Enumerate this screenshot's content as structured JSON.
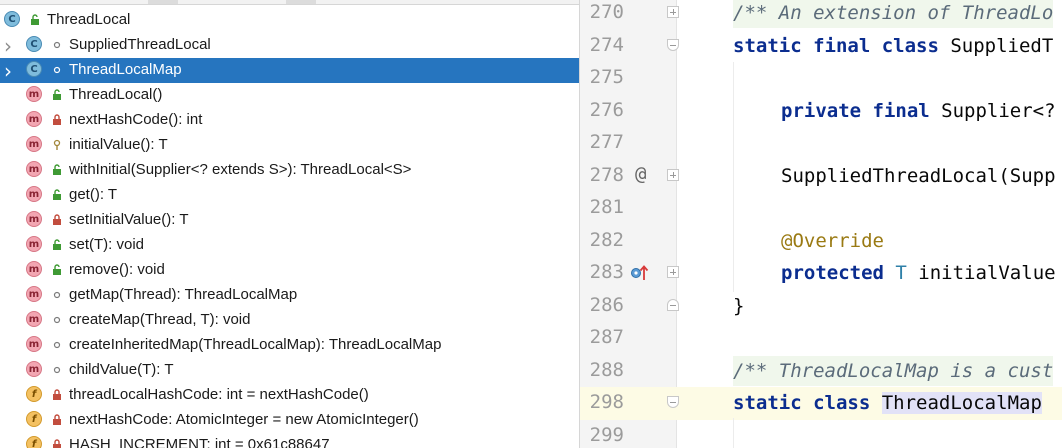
{
  "structure": {
    "root": {
      "label": "ThreadLocal",
      "icon": "class-icon",
      "visibility": "public"
    },
    "items": [
      {
        "label": "SuppliedThreadLocal",
        "icon": "class-icon",
        "visibility": "package",
        "expandable": true
      },
      {
        "label": "ThreadLocalMap",
        "icon": "class-icon",
        "visibility": "package",
        "expandable": true,
        "selected": true
      },
      {
        "label": "ThreadLocal()",
        "icon": "method-icon",
        "visibility": "public"
      },
      {
        "label": "nextHashCode(): int",
        "icon": "method-icon",
        "visibility": "private"
      },
      {
        "label": "initialValue(): T",
        "icon": "method-icon",
        "visibility": "protected"
      },
      {
        "label": "withInitial(Supplier<? extends S>): ThreadLocal<S>",
        "icon": "method-icon",
        "visibility": "public"
      },
      {
        "label": "get(): T",
        "icon": "method-icon",
        "visibility": "public"
      },
      {
        "label": "setInitialValue(): T",
        "icon": "method-icon",
        "visibility": "private"
      },
      {
        "label": "set(T): void",
        "icon": "method-icon",
        "visibility": "public"
      },
      {
        "label": "remove(): void",
        "icon": "method-icon",
        "visibility": "public"
      },
      {
        "label": "getMap(Thread): ThreadLocalMap",
        "icon": "method-icon",
        "visibility": "package"
      },
      {
        "label": "createMap(Thread, T): void",
        "icon": "method-icon",
        "visibility": "package"
      },
      {
        "label": "createInheritedMap(ThreadLocalMap): ThreadLocalMap",
        "icon": "method-icon",
        "visibility": "package"
      },
      {
        "label": "childValue(T): T",
        "icon": "method-icon",
        "visibility": "package"
      },
      {
        "label": "threadLocalHashCode: int = nextHashCode()",
        "icon": "field-icon",
        "visibility": "private"
      },
      {
        "label": "nextHashCode: AtomicInteger = new AtomicInteger()",
        "icon": "field-icon",
        "visibility": "private"
      },
      {
        "label": "HASH_INCREMENT: int = 0x61c88647",
        "icon": "field-icon",
        "visibility": "private"
      }
    ],
    "icon_letters": {
      "class-icon": "C",
      "method-icon": "m",
      "field-icon": "f"
    }
  },
  "editor": {
    "lines": [
      {
        "num": "270",
        "fold": "plus",
        "tokens": [
          [
            "cm",
            "/** An extension of ThreadLo"
          ]
        ],
        "indent": 1,
        "comment_bg": true
      },
      {
        "num": "274",
        "fold": "open",
        "tokens": [
          [
            "kw",
            "static final class"
          ],
          [
            "pl",
            " SuppliedT"
          ]
        ],
        "indent": 1
      },
      {
        "num": "275",
        "tokens": [],
        "indent": 1
      },
      {
        "num": "276",
        "tokens": [
          [
            "kw",
            "private final"
          ],
          [
            "pl",
            " Supplier<?"
          ]
        ],
        "indent": 2
      },
      {
        "num": "277",
        "tokens": [],
        "indent": 2
      },
      {
        "num": "278",
        "mark": "@",
        "fold": "plus",
        "tokens": [
          [
            "pl",
            "SuppliedThreadLocal(Supp"
          ]
        ],
        "indent": 2
      },
      {
        "num": "281",
        "tokens": [],
        "indent": 2
      },
      {
        "num": "282",
        "tokens": [
          [
            "ann",
            "@Override"
          ]
        ],
        "indent": 2
      },
      {
        "num": "283",
        "mark": "override",
        "fold": "plus",
        "tokens": [
          [
            "kw",
            "protected"
          ],
          [
            "pl",
            " "
          ],
          [
            "ty",
            "T"
          ],
          [
            "pl",
            " initialValue"
          ]
        ],
        "indent": 2
      },
      {
        "num": "286",
        "fold": "close",
        "tokens": [
          [
            "pl",
            "}"
          ]
        ],
        "indent": 1
      },
      {
        "num": "287",
        "tokens": [],
        "indent": 1
      },
      {
        "num": "288",
        "tokens": [
          [
            "cm",
            "/** ThreadLocalMap is a cust"
          ]
        ],
        "indent": 1,
        "comment_bg": true
      },
      {
        "num": "298",
        "fold": "open",
        "current": true,
        "tokens": [
          [
            "kw",
            "static class"
          ],
          [
            "pl",
            " "
          ],
          [
            "hl",
            "ThreadLocalMap"
          ],
          [
            "pl",
            " "
          ]
        ],
        "indent": 1
      },
      {
        "num": "299",
        "tokens": [],
        "indent": 1
      }
    ]
  },
  "colors": {
    "selection": "#2675bf",
    "keyword": "#0b2d8f",
    "comment": "#5b6b7a",
    "annotation": "#9a7a13",
    "type_param": "#2f80a8",
    "identifier_highlight": "#e2e2f7",
    "current_line": "#fdfbe5"
  }
}
